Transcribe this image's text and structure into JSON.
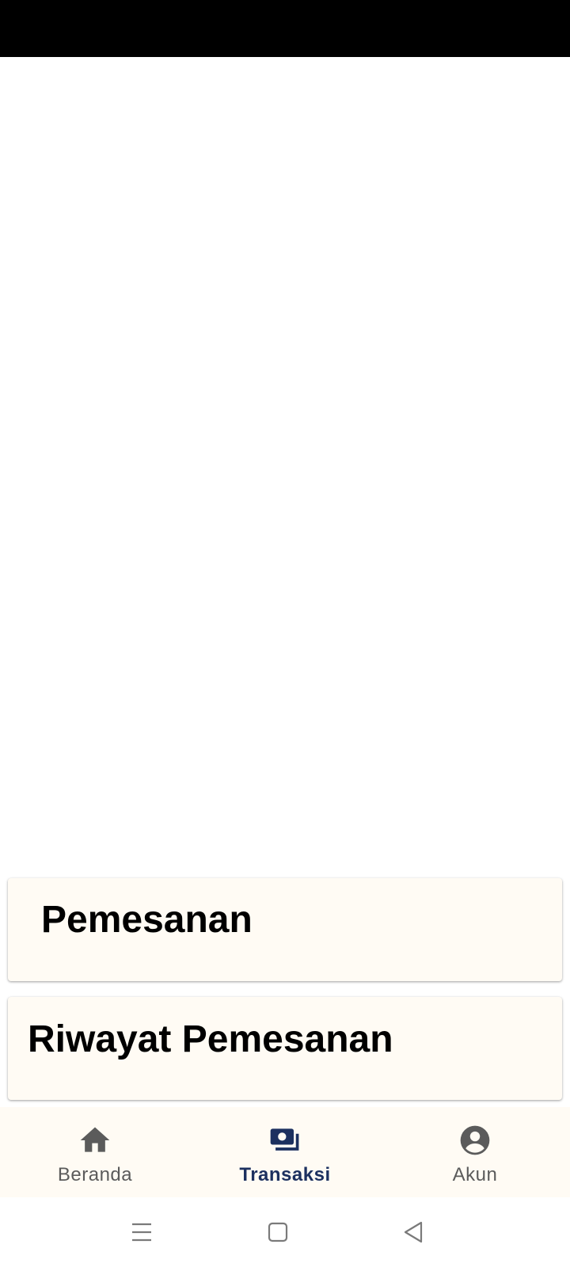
{
  "cards": [
    {
      "label": "Pemesanan"
    },
    {
      "label": "Riwayat Pemesanan"
    }
  ],
  "bottom_nav": {
    "items": [
      {
        "label": "Beranda",
        "icon": "home-icon",
        "active": false
      },
      {
        "label": "Transaksi",
        "icon": "money-icon",
        "active": true
      },
      {
        "label": "Akun",
        "icon": "account-circle-icon",
        "active": false
      }
    ],
    "active_color": "#1c305f",
    "inactive_color": "#5b5b5b"
  },
  "system_nav": {
    "icons": [
      "menu-icon",
      "home-square-icon",
      "back-triangle-icon"
    ]
  },
  "colors": {
    "status_bar": "#000000",
    "card_background": "#fffbf4",
    "page_background": "#ffffff"
  }
}
